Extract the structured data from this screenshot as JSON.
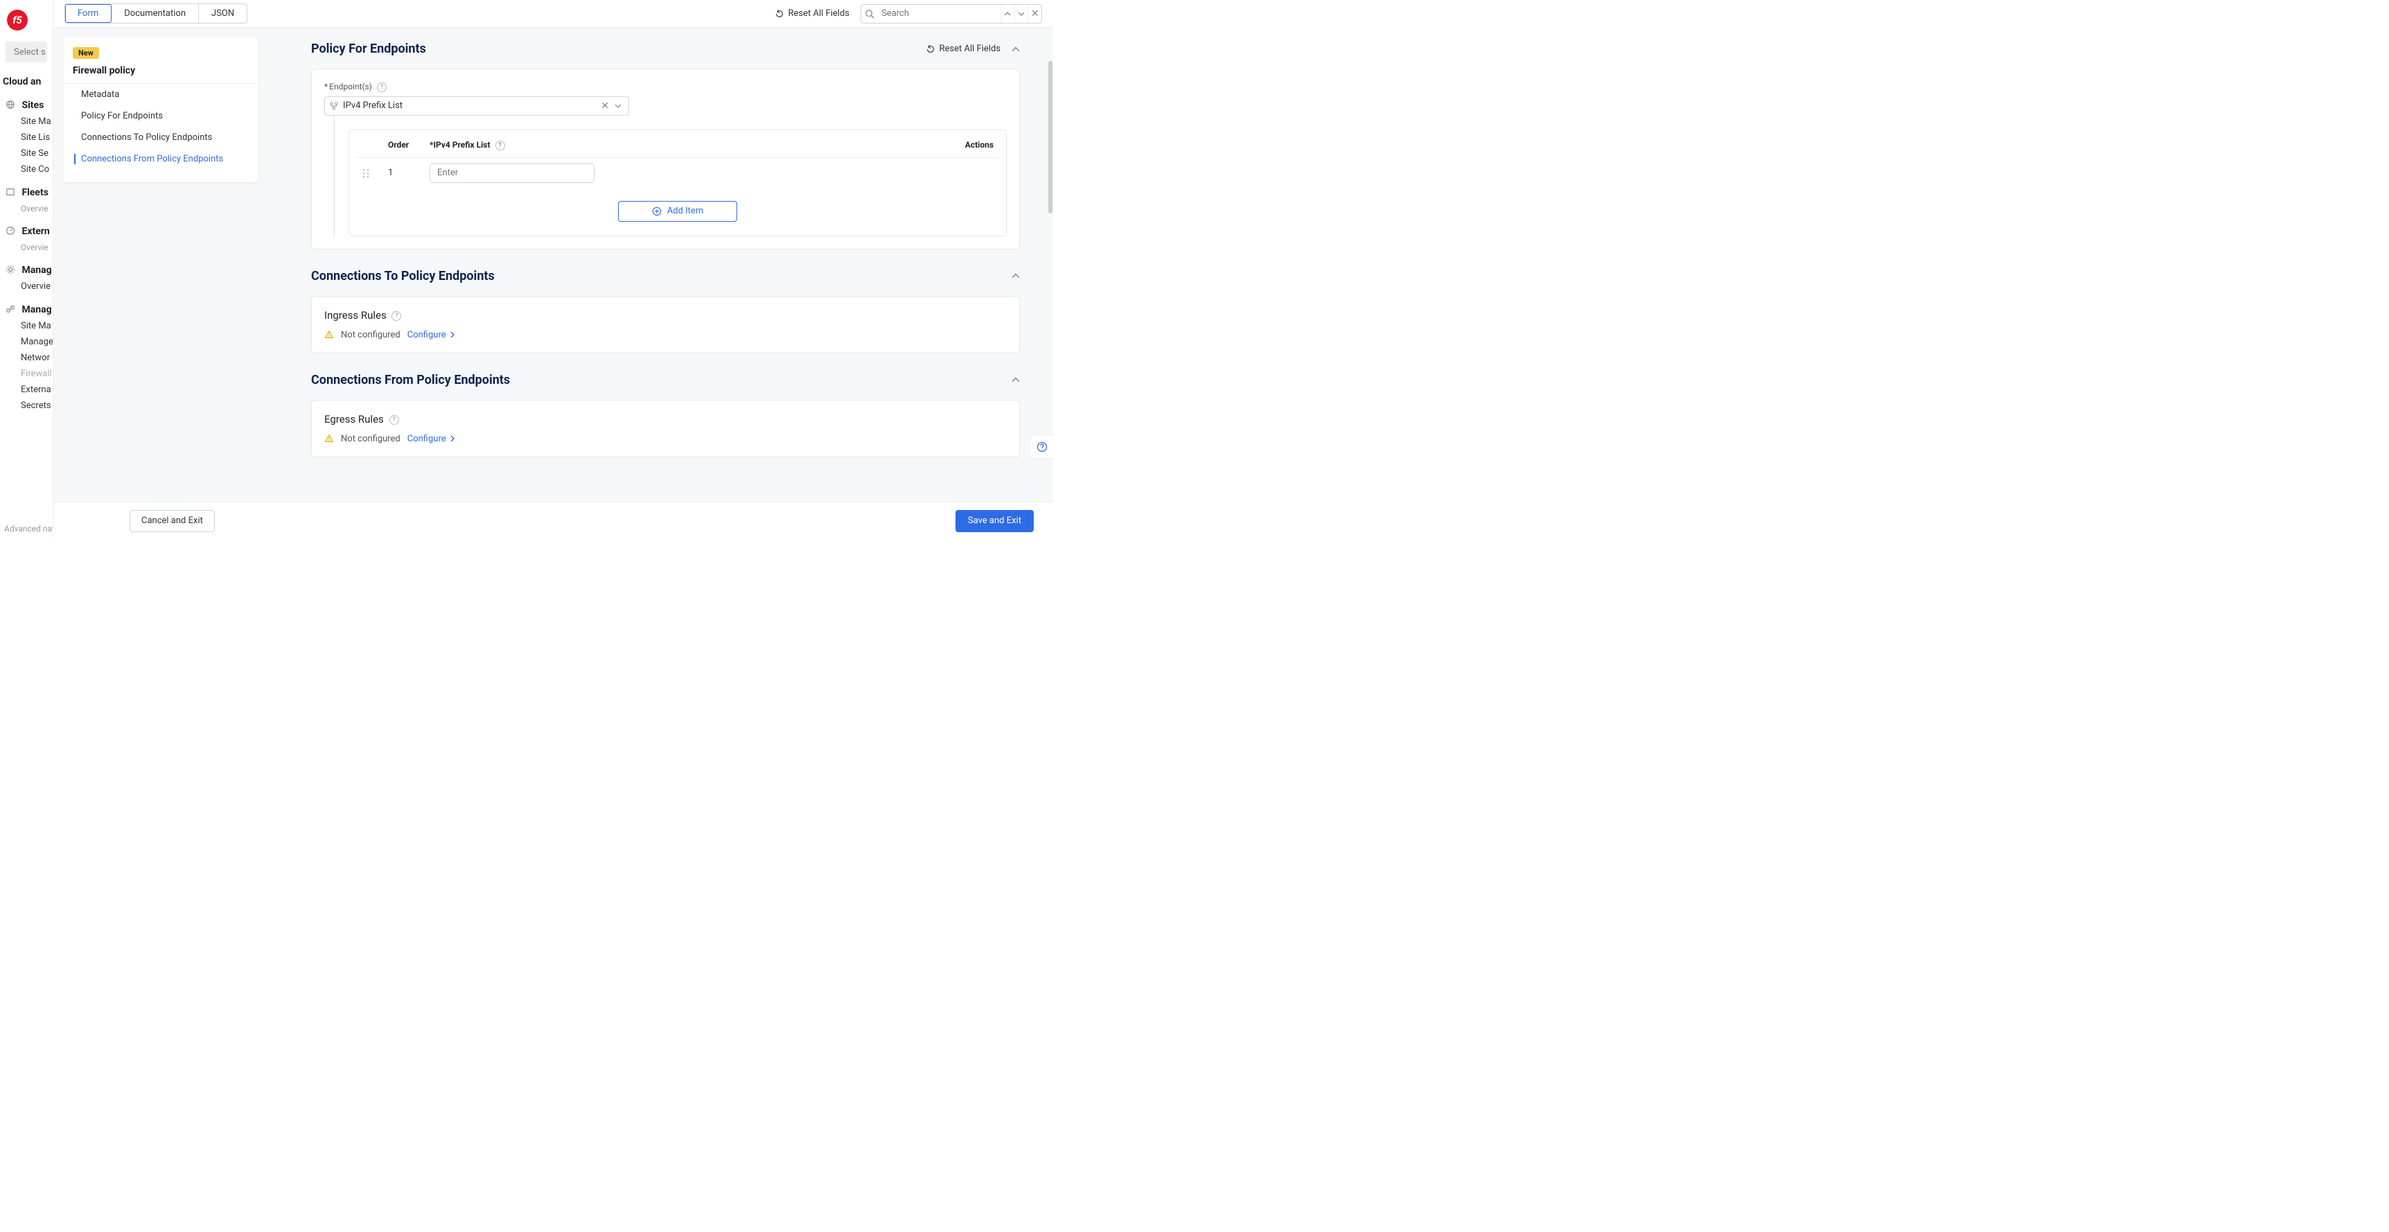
{
  "bg": {
    "select": "Select s",
    "group1": "Cloud an",
    "sites": "Sites",
    "sites_items": [
      "Site Ma",
      "Site Lis",
      "Site Se",
      "Site Co"
    ],
    "fleets": "Fleets",
    "fleets_sub": "Overvie",
    "external": "Extern",
    "external_sub": "Overvie",
    "manage1": "Manag",
    "manage1_items": [
      "Overvie"
    ],
    "manage2": "Manag",
    "manage2_items": [
      "Site Ma",
      "Manage",
      "Networ",
      "Firewall",
      "Externa",
      "Secrets"
    ],
    "adv": "Advanced nav"
  },
  "topbar": {
    "tabs": [
      "Form",
      "Documentation",
      "JSON"
    ],
    "reset": "Reset All Fields",
    "search_ph": "Search"
  },
  "nav": {
    "badge": "New",
    "title": "Firewall policy",
    "items": [
      "Metadata",
      "Policy For Endpoints",
      "Connections To Policy Endpoints",
      "Connections From Policy Endpoints"
    ]
  },
  "policy": {
    "title": "Policy For Endpoints",
    "reset": "Reset All Fields",
    "endpoint_label": "Endpoint(s)",
    "combo_value": "IPv4 Prefix List",
    "th_order": "Order",
    "th_main": "*IPv4 Prefix List",
    "th_actions": "Actions",
    "row_order": "1",
    "row_ph": "Enter",
    "add": "Add Item"
  },
  "conn_to": {
    "title": "Connections To Policy Endpoints",
    "sub": "Ingress Rules",
    "status": "Not configured",
    "configure": "Configure"
  },
  "conn_from": {
    "title": "Connections From Policy Endpoints",
    "sub": "Egress Rules",
    "status": "Not configured",
    "configure": "Configure"
  },
  "footer": {
    "cancel": "Cancel and Exit",
    "save": "Save and Exit"
  }
}
